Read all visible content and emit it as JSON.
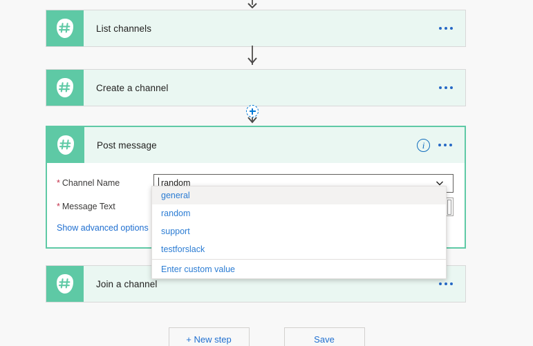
{
  "colors": {
    "accent_teal": "#5ec9a5",
    "card_bg": "#eaf7f2",
    "link_blue": "#2b7cd3",
    "required_red": "#c4314b",
    "page_bg": "#f8f8f8"
  },
  "flow": {
    "top_connector_arrow_icon": "arrow-down-icon",
    "add_step_icon": "plus-circle-icon",
    "cards": [
      {
        "id": "list-channels",
        "title": "List channels",
        "icon": "slack-hash-icon",
        "menu_icon": "ellipsis-icon",
        "selected": false,
        "expanded": false
      },
      {
        "id": "create-a-channel",
        "title": "Create a channel",
        "icon": "slack-hash-icon",
        "menu_icon": "ellipsis-icon",
        "selected": false,
        "expanded": false
      },
      {
        "id": "post-message",
        "title": "Post message",
        "icon": "slack-hash-icon",
        "info_icon": "info-circle-icon",
        "menu_icon": "ellipsis-icon",
        "selected": true,
        "expanded": true
      },
      {
        "id": "join-a-channel",
        "title": "Join a channel",
        "icon": "slack-hash-icon",
        "menu_icon": "ellipsis-icon",
        "selected": false,
        "expanded": false
      }
    ]
  },
  "post_message_form": {
    "channel_name": {
      "required_marker": "*",
      "label": "Channel Name",
      "value": "random",
      "placeholder": "",
      "caret_icon": "chevron-down-icon"
    },
    "message_text": {
      "required_marker": "*",
      "label": "Message Text",
      "value": "",
      "placeholder": ""
    },
    "advanced": {
      "label": "Show advanced options",
      "caret_icon": "chevron-down-icon"
    }
  },
  "dropdown": {
    "visible": true,
    "options": [
      {
        "label": "general",
        "selected": true
      },
      {
        "label": "random",
        "selected": false
      },
      {
        "label": "support",
        "selected": false
      },
      {
        "label": "testforslack",
        "selected": false
      }
    ],
    "custom_option": "Enter custom value"
  },
  "footer": {
    "new_step_label": "+ New step",
    "save_label": "Save"
  }
}
